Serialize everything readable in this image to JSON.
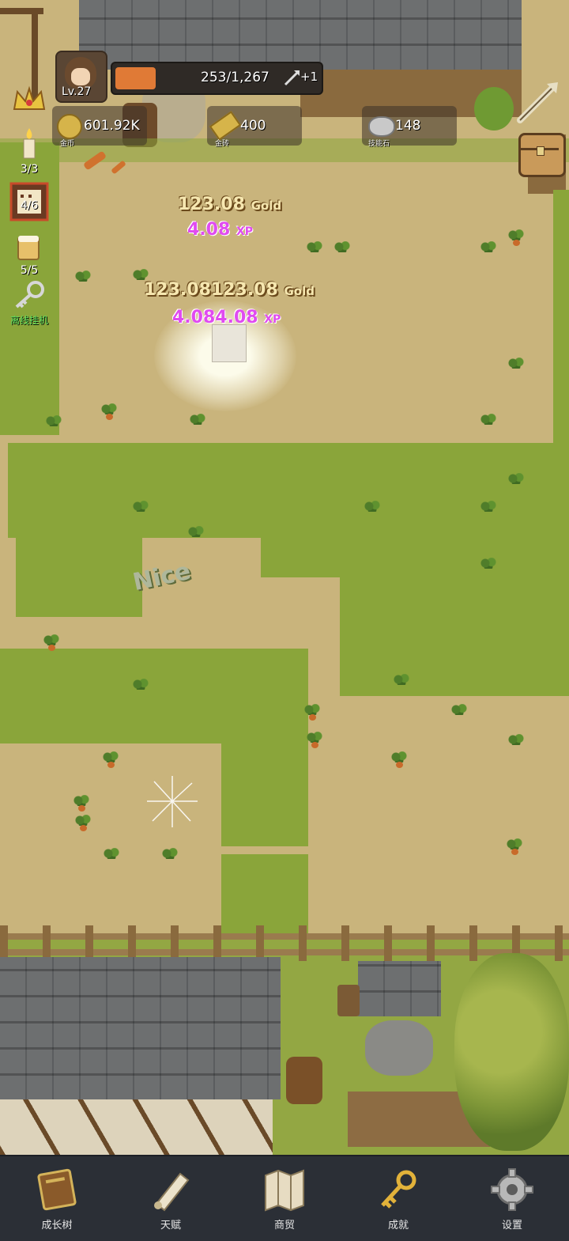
{
  "player": {
    "level": "Lv.27",
    "xp_text": "253/1,267",
    "xp_progress": 0.2,
    "bonus": "+1"
  },
  "currencies": [
    {
      "icon": "gold-coin-icon",
      "value": "601.92K",
      "label": "金币"
    },
    {
      "icon": "gold-brick-icon",
      "value": "400",
      "label": "金砖"
    },
    {
      "icon": "skill-stone-icon",
      "value": "148",
      "label": "技能石"
    }
  ],
  "side_buttons": [
    {
      "icon": "crown-icon",
      "label": ""
    },
    {
      "icon": "candle-icon",
      "label": "3/3"
    },
    {
      "icon": "scroll-calendar-icon",
      "label": "4/6"
    },
    {
      "icon": "beer-mug-icon",
      "label": "5/5"
    },
    {
      "icon": "key-icon",
      "label": "离线挂机"
    }
  ],
  "floating_texts": {
    "gold_1": "123.08",
    "gold_2": "123.08123.08",
    "gold_unit": "Gold",
    "xp_1": "4.08",
    "xp_2": "4.084.08",
    "xp_unit": "XP",
    "praise": "Nice"
  },
  "nav": [
    {
      "icon": "book-icon",
      "label": "成长树"
    },
    {
      "icon": "scroll-icon",
      "label": "天赋"
    },
    {
      "icon": "map-icon",
      "label": "商贸"
    },
    {
      "icon": "key-icon",
      "label": "成就"
    },
    {
      "icon": "gear-icon",
      "label": "设置"
    }
  ],
  "colors": {
    "dirt": "#c9b47c",
    "grass": "#8aa53a",
    "xp_bar": "#e07a36",
    "xp_text": "#e04bf0",
    "nav_bg": "#2b2f36"
  }
}
